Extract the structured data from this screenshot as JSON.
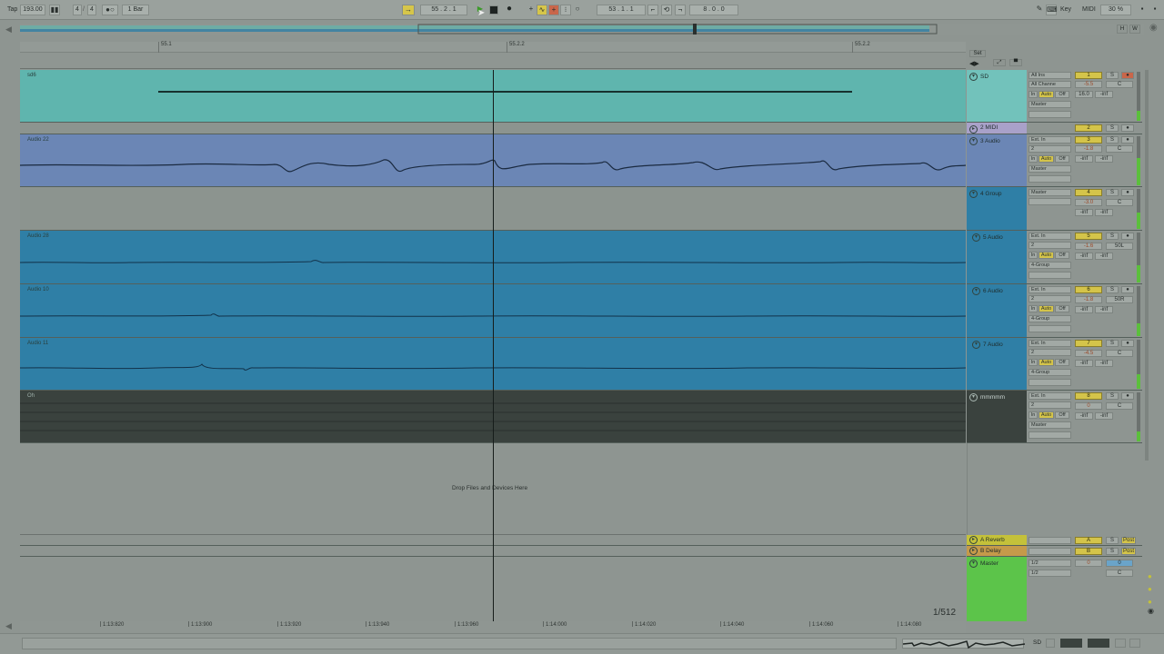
{
  "toolbar": {
    "tap": "Tap",
    "tempo": "193.00",
    "time_sig_num": "4",
    "time_sig_den": "4",
    "quantize": "1 Bar",
    "position": "55 .   2 .   1",
    "loop_start": "53 .   1 .   1",
    "loop_length": "8 .   0 .   0",
    "key": "Key",
    "midi": "MIDI",
    "cpu": "30 %"
  },
  "overview": {
    "h_label": "H",
    "w_label": "W"
  },
  "ruler": {
    "bars": [
      "55.1",
      "55.2.2",
      "55.2.2"
    ]
  },
  "set_button": "Set",
  "tracks": [
    {
      "clip": "sd6",
      "name": "SD",
      "input": "All Ins",
      "channel": "All Channe",
      "monitor_in": "In",
      "monitor_auto": "Auto",
      "monitor_off": "Off",
      "output": "Master",
      "number": "1",
      "volume": "-5.5",
      "pan": "C",
      "send": "16.0",
      "send2": "-inf",
      "solo": "S"
    },
    {
      "clip": "",
      "name": "2 MIDI",
      "number": "2",
      "solo": "S"
    },
    {
      "clip": "Audio 22",
      "name": "3 Audio",
      "input": "Ext. In",
      "input2": "2",
      "monitor_in": "In",
      "monitor_auto": "Auto",
      "monitor_off": "Off",
      "output": "Master",
      "number": "3",
      "volume": "-1.8",
      "pan": "C",
      "send": "-inf",
      "send2": "-inf",
      "solo": "S"
    },
    {
      "clip": "",
      "name": "4 Group",
      "output": "Master",
      "number": "4",
      "volume": "-3.0",
      "pan": "C",
      "send": "-inf",
      "send2": "-inf",
      "solo": "S"
    },
    {
      "clip": "Audio 28",
      "name": "5 Audio",
      "input": "Ext. In",
      "input2": "2",
      "monitor_in": "In",
      "monitor_auto": "Auto",
      "monitor_off": "Off",
      "output": "4-Group",
      "number": "5",
      "volume": "-1.6",
      "pan": "50L",
      "send": "-inf",
      "send2": "-inf",
      "solo": "S"
    },
    {
      "clip": "Audio 10",
      "name": "6 Audio",
      "input": "Ext. In",
      "input2": "2",
      "monitor_in": "In",
      "monitor_auto": "Auto",
      "monitor_off": "Off",
      "output": "4-Group",
      "number": "6",
      "volume": "-1.8",
      "pan": "50R",
      "send": "-inf",
      "send2": "-inf",
      "solo": "S"
    },
    {
      "clip": "Audio 11",
      "name": "7 Audio",
      "input": "Ext. In",
      "input2": "2",
      "monitor_in": "In",
      "monitor_auto": "Auto",
      "monitor_off": "Off",
      "output": "4-Group",
      "number": "7",
      "volume": "-4.5",
      "pan": "C",
      "send": "-inf",
      "send2": "-inf",
      "solo": "S"
    },
    {
      "clip": "Oh",
      "name": "mmmmm",
      "input": "Ext. In",
      "input2": "2",
      "monitor_in": "In",
      "monitor_auto": "Auto",
      "monitor_off": "Off",
      "output": "Master",
      "number": "8",
      "volume": "0",
      "pan": "C",
      "send": "-inf",
      "send2": "-inf",
      "solo": "S"
    }
  ],
  "drop_zone": "Drop Files and Devices Here",
  "returns": [
    {
      "name": "A Reverb",
      "letter": "A",
      "solo": "S",
      "post": "Post"
    },
    {
      "name": "B Delay",
      "letter": "B",
      "solo": "S",
      "post": "Post"
    }
  ],
  "master": {
    "name": "Master",
    "out1": "1/2",
    "out2": "1/2",
    "volume": "0",
    "pan": "C",
    "cue": "0"
  },
  "zoom_ratio": "1/512",
  "time_axis": [
    "1:13:820",
    "1:13:900",
    "1:13:920",
    "1:13:940",
    "1:13:960",
    "1:14:000",
    "1:14:020",
    "1:14:040",
    "1:14:060",
    "1:14:080",
    "1:14:100"
  ],
  "status": {
    "track_label": "SD"
  },
  "colors": {
    "sd_clip": "#5fb5ae",
    "audio22_clip": "#6b86b5",
    "group_lane": "#8c948f",
    "blue_clip": "#2f7fa6",
    "oh_clip": "#3a423e",
    "midi_head": "#a9a1c9",
    "group_head": "#2f7fa6",
    "reverb": "#c4c13a",
    "delay": "#c59a4a",
    "master": "#5cc44a"
  }
}
